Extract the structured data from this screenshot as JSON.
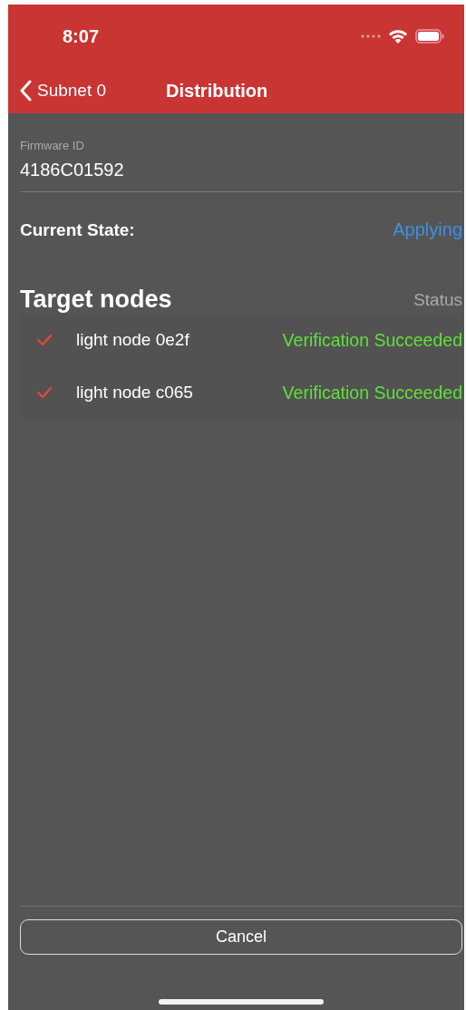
{
  "status_bar": {
    "time": "8:07"
  },
  "nav": {
    "back": "Subnet 0",
    "title": "Distribution"
  },
  "firmware": {
    "label": "Firmware ID",
    "value": "4186C01592"
  },
  "current_state": {
    "label": "Current State:",
    "value": "Applying"
  },
  "targets": {
    "title": "Target nodes",
    "status_heading": "Status",
    "nodes": [
      {
        "name": "light node 0e2f",
        "status": "Verification Succeeded",
        "checked": true
      },
      {
        "name": "light node c065",
        "status": "Verification Succeeded",
        "checked": true
      }
    ]
  },
  "buttons": [
    "Cancel"
  ]
}
